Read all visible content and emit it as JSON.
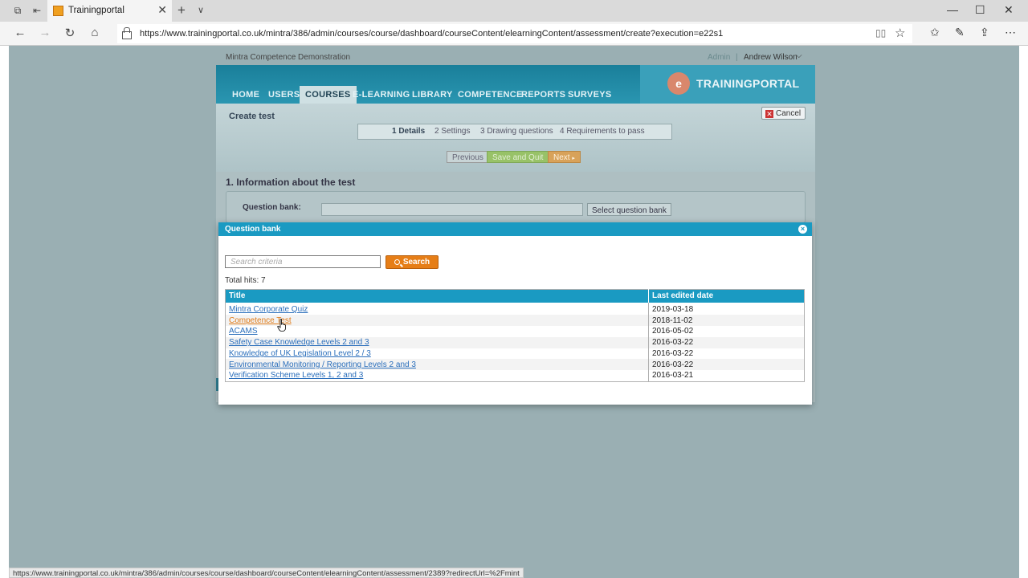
{
  "browser": {
    "tab_title": "Trainingportal",
    "url": "https://www.trainingportal.co.uk/mintra/386/admin/courses/course/dashboard/courseContent/elearningContent/assessment/create?execution=e22s1",
    "status_url": "https://www.trainingportal.co.uk/mintra/386/admin/courses/course/dashboard/courseContent/elearningContent/assessment/2389?redirectUrl=%2Fmint"
  },
  "topbar": {
    "site_name": "Mintra Competence Demonstration",
    "admin_label": "Admin",
    "separator": "|",
    "user_name": "Andrew Wilson"
  },
  "logo": {
    "mark": "e",
    "text": "TRAININGPORTAL"
  },
  "menu": [
    "HOME",
    "USERS",
    "COURSES",
    "E-LEARNING",
    "LIBRARY",
    "COMPETENCE",
    "REPORTS",
    "SURVEYS"
  ],
  "page": {
    "title": "Create test",
    "cancel_label": "Cancel",
    "steps": [
      "1 Details",
      "2 Settings",
      "3 Drawing questions",
      "4 Requirements to pass"
    ],
    "prev_label": "Previous",
    "save_label": "Save and Quit",
    "next_label": "Next",
    "section_title": "1. Information about the test",
    "qb_label": "Question bank:",
    "qb_button": "Select question bank"
  },
  "modal": {
    "title": "Question bank",
    "close_glyph": "×",
    "search_placeholder": "Search criteria",
    "search_label": "Search",
    "total_hits": "Total hits: 7",
    "columns": {
      "title": "Title",
      "date": "Last edited date"
    },
    "rows": [
      {
        "title": "Mintra Corporate Quiz",
        "date": "2019-03-18"
      },
      {
        "title": "Competence Test",
        "date": "2018-11-02"
      },
      {
        "title": "ACAMS",
        "date": "2016-05-02"
      },
      {
        "title": "Safety Case Knowledge Levels 2 and 3",
        "date": "2016-03-22"
      },
      {
        "title": "Knowledge of UK Legislation Level 2 / 3",
        "date": "2016-03-22"
      },
      {
        "title": "Environmental Monitoring / Reporting Levels 2 and 3",
        "date": "2016-03-22"
      },
      {
        "title": "Verification Scheme Levels 1, 2 and 3",
        "date": "2016-03-21"
      }
    ]
  }
}
